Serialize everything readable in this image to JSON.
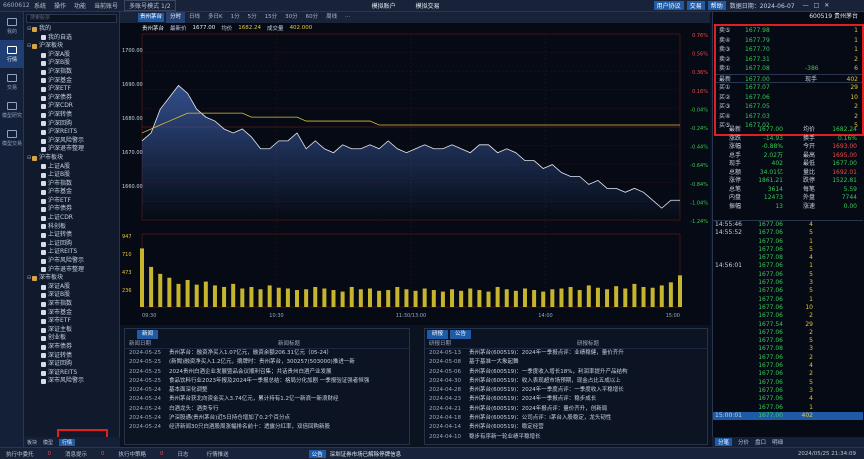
{
  "topbar": {
    "app_id": "6600612",
    "menu": [
      "系统",
      "操作",
      "功能",
      "当前账号"
    ],
    "mode_select": "多账号模式 1/2",
    "center1": "模拟账户",
    "center2": "模拟交易",
    "user_btn": "用户协议",
    "right_btn1": "交易",
    "right_btn2": "帮助",
    "date_text": "数据日期：2024-06-07",
    "colors": {
      "accent": "#1f5aa6",
      "up": "#f04a4a",
      "down": "#39c956"
    }
  },
  "rail": [
    {
      "label": "我的",
      "icon": "user-icon"
    },
    {
      "label": "行情",
      "icon": "chart-icon"
    },
    {
      "label": "交易",
      "icon": "trade-icon"
    },
    {
      "label": "模型研究",
      "icon": "model-icon"
    },
    {
      "label": "模型交易",
      "icon": "robot-icon"
    }
  ],
  "tree": {
    "search_placeholder": "搜索股票",
    "nodes": [
      {
        "label": "我的",
        "lvl": 0,
        "folder": true
      },
      {
        "label": "我的自选",
        "lvl": 1
      },
      {
        "label": "沪深板块",
        "lvl": 0,
        "folder": true
      },
      {
        "label": "沪深A股",
        "lvl": 1
      },
      {
        "label": "沪深B股",
        "lvl": 1
      },
      {
        "label": "沪深指数",
        "lvl": 1
      },
      {
        "label": "沪深基金",
        "lvl": 1
      },
      {
        "label": "沪深ETF",
        "lvl": 1
      },
      {
        "label": "沪深债券",
        "lvl": 1
      },
      {
        "label": "沪深CDR",
        "lvl": 1
      },
      {
        "label": "沪深转债",
        "lvl": 1
      },
      {
        "label": "沪深回购",
        "lvl": 1
      },
      {
        "label": "沪深REITS",
        "lvl": 1
      },
      {
        "label": "沪深风险警示",
        "lvl": 1
      },
      {
        "label": "沪深退市整理",
        "lvl": 1
      },
      {
        "label": "沪市板块",
        "lvl": 0,
        "folder": true
      },
      {
        "label": "上证A股",
        "lvl": 1
      },
      {
        "label": "上证B股",
        "lvl": 1
      },
      {
        "label": "沪市指数",
        "lvl": 1
      },
      {
        "label": "沪市基金",
        "lvl": 1
      },
      {
        "label": "沪市ETF",
        "lvl": 1
      },
      {
        "label": "沪市债券",
        "lvl": 1
      },
      {
        "label": "上证CDR",
        "lvl": 1
      },
      {
        "label": "科创板",
        "lvl": 1
      },
      {
        "label": "上证转债",
        "lvl": 1
      },
      {
        "label": "上证回购",
        "lvl": 1
      },
      {
        "label": "上证REITS",
        "lvl": 1
      },
      {
        "label": "沪市风险警示",
        "lvl": 1
      },
      {
        "label": "沪市退市整理",
        "lvl": 1
      },
      {
        "label": "深市板块",
        "lvl": 0,
        "folder": true
      },
      {
        "label": "深证A股",
        "lvl": 1
      },
      {
        "label": "深证B股",
        "lvl": 1
      },
      {
        "label": "深市指数",
        "lvl": 1
      },
      {
        "label": "深市基金",
        "lvl": 1
      },
      {
        "label": "深市ETF",
        "lvl": 1
      },
      {
        "label": "深证主板",
        "lvl": 1
      },
      {
        "label": "创业板",
        "lvl": 1
      },
      {
        "label": "深市债券",
        "lvl": 1
      },
      {
        "label": "深证转债",
        "lvl": 1
      },
      {
        "label": "深证回购",
        "lvl": 1
      },
      {
        "label": "深证REITS",
        "lvl": 1
      },
      {
        "label": "深市风险警示",
        "lvl": 1
      }
    ],
    "bottom_tabs": [
      "板块",
      "模型",
      "行情"
    ]
  },
  "chart": {
    "stock_button": "贵州茅台",
    "tabs": [
      "分时",
      "日线",
      "多日K",
      "1分",
      "5分",
      "15分",
      "30分",
      "60分",
      "周线",
      "···"
    ],
    "info": [
      "贵州茅台",
      "最新价",
      "1677.00",
      "均价",
      "1682.24",
      "成交量",
      "402.000"
    ],
    "left_axis": [
      "1700.00",
      "1690.00",
      "1680.00",
      "1670.00",
      "1660.00"
    ],
    "right_axis": [
      "0.76%",
      "0.56%",
      "0.36%",
      "0.16%",
      "-0.04%",
      "-0.24%",
      "-0.44%",
      "-0.64%",
      "-0.84%",
      "-1.04%",
      "-1.24%"
    ],
    "vol_axis": [
      "947",
      "710",
      "473",
      "236"
    ],
    "chart_data": {
      "type": "line",
      "xlabel": "",
      "ylabel": "",
      "ylim": [
        1658,
        1705
      ],
      "series": [
        {
          "name": "",
          "values": [
            1678,
            1680,
            1686,
            1689,
            1692,
            1690,
            1686,
            1684,
            1683,
            1681,
            1680,
            1681,
            1679,
            1676,
            1676,
            1678,
            1678,
            1680,
            1676,
            1678,
            1676,
            1675,
            1677,
            1676,
            1676,
            1677,
            1676,
            1678,
            1676,
            1675,
            1676,
            1677,
            1676,
            1676,
            1677,
            1676,
            1675,
            1677,
            1677,
            1675,
            1676,
            1675,
            1673,
            1673,
            1671,
            1672,
            1670,
            1669,
            1669,
            1667,
            1668,
            1666,
            1666,
            1665,
            1666,
            1665,
            1663,
            1661,
            1663,
            1663
          ]
        },
        {
          "name": "",
          "values": [
            1680,
            1681,
            1682,
            1683,
            1684,
            1685,
            1685,
            1685,
            1685,
            1685,
            1685,
            1685,
            1684,
            1684,
            1684,
            1684,
            1684,
            1684,
            1683,
            1683,
            1683,
            1683,
            1683,
            1683,
            1683,
            1683,
            1682,
            1682,
            1682,
            1682,
            1682,
            1682,
            1682,
            1682,
            1682,
            1682,
            1682,
            1682,
            1682,
            1682,
            1682,
            1682,
            1682,
            1682,
            1682,
            1682,
            1682,
            1682,
            1682,
            1682,
            1682,
            1682,
            1682,
            1682,
            1682,
            1682,
            1682,
            1682,
            1682,
            1682
          ]
        }
      ],
      "volume": [
        760,
        520,
        430,
        380,
        300,
        350,
        290,
        330,
        280,
        260,
        300,
        240,
        260,
        230,
        280,
        250,
        240,
        220,
        230,
        260,
        240,
        220,
        200,
        260,
        230,
        240,
        210,
        220,
        260,
        230,
        210,
        240,
        220,
        200,
        230,
        210,
        240,
        220,
        200,
        260,
        230,
        210,
        240,
        220,
        200,
        230,
        240,
        260,
        220,
        280,
        250,
        230,
        270,
        240,
        300,
        260,
        250,
        280,
        320,
        410
      ],
      "x_ticks": [
        "09:30",
        "10:30",
        "11:30/13:00",
        "14:00",
        "15:00"
      ]
    }
  },
  "news_left": {
    "buttons": [
      "新闻"
    ],
    "headers": [
      "新闻日期",
      "新闻标题"
    ],
    "rows": [
      [
        "2024-05-25",
        "贵州茅台：融资净买入1.07亿元，融资余额206.31亿元（05-24）"
      ],
      [
        "2024-05-25",
        "(新聞)融资净买入1.2亿元，摘牌时：贵州茅台，300257(503000)推进一新"
      ],
      [
        "2024-05-25",
        "2024贵州白酒企业发展暨品会议顺利召集；共话贵州白酒产业发展"
      ],
      [
        "2024-05-25",
        "食品饮料行业2023年报及2024年一季报总结：格局分化加剧 一季报验证强者恒强"
      ],
      [
        "2024-05-24",
        "基本面深化调整"
      ],
      [
        "2024-05-24",
        "贵州茅台获北向资金买入3.74亿元，累计持有1.2亿一新浪一新浪财经"
      ],
      [
        "2024-05-24",
        "白酒龙头：酒类专行"
      ],
      [
        "2024-05-24",
        "沪深股通(贵州茅台)近5日持仓增加了0.2个百分点"
      ],
      [
        "2024-05-24",
        "经济新闻30只白酒股周涨幅排名前十：透露分红率，双倍回购新股"
      ]
    ]
  },
  "news_right": {
    "buttons": [
      "研报",
      "公告"
    ],
    "headers": [
      "研报日期",
      "研报标题"
    ],
    "rows": [
      [
        "2024-05-13",
        "贵州茅台(600519)：2024年一季报点评：业绩稳健，量价齐升"
      ],
      [
        "2024-05-08",
        "基于基准一大象起舞"
      ],
      [
        "2024-05-06",
        "贵州茅台(600519)：一季度收入增长18%，利润率提升产品结构"
      ],
      [
        "2024-04-30",
        "贵州茅台(600519)：收入表现超市场预期，现金占比五成以上"
      ],
      [
        "2024-04-28",
        "贵州茅台(600519)：2024年一季度点评：一季度收入平稳增长"
      ],
      [
        "2024-04-23",
        "贵州茅台(600519)：2024年一季报点评：稳步成长"
      ],
      [
        "2024-04-21",
        "贵州茅台(600519)：2024年报点评：量价齐升，创新局"
      ],
      [
        "2024-04-18",
        "贵州茅台(600519)：公司点评：i茅台入股稳定，龙头韧性"
      ],
      [
        "2024-04-14",
        "贵州茅台(600519)：稳定经营"
      ],
      [
        "2024-04-10",
        "稳步有序新一轮业绩平稳增长"
      ]
    ]
  },
  "order_book": {
    "header": "600519 贵州茅台",
    "sells": [
      [
        "卖⑤",
        "1677.98",
        "1",
        ""
      ],
      [
        "卖④",
        "1677.79",
        "1",
        ""
      ],
      [
        "卖③",
        "1677.70",
        "1",
        ""
      ],
      [
        "卖②",
        "1677.31",
        "2",
        ""
      ],
      [
        "卖①",
        "1677.08",
        "6",
        "-386"
      ]
    ],
    "last": [
      "最新",
      "1677.00",
      "现手",
      "402"
    ],
    "buys": [
      [
        "买①",
        "1677.07",
        "29",
        ""
      ],
      [
        "买②",
        "1677.06",
        "10",
        ""
      ],
      [
        "买③",
        "1677.05",
        "2",
        ""
      ],
      [
        "买④",
        "1677.03",
        "2",
        ""
      ],
      [
        "买⑤",
        "1677.02",
        "5",
        ""
      ]
    ]
  },
  "quote": [
    [
      "最新",
      "1677.00",
      "均价",
      "1682.24"
    ],
    [
      "涨跌",
      "-14.93",
      "换手",
      "0.16%"
    ],
    [
      "涨幅",
      "-0.88%",
      "今开",
      "1693.00"
    ],
    [
      "总手",
      "2.02万",
      "最高",
      "1695.00"
    ],
    [
      "现手",
      "402",
      "最低",
      "1677.00"
    ],
    [
      "总额",
      "34.01亿",
      "量比",
      "1692.01"
    ],
    [
      "涨停",
      "1861.21",
      "跌停",
      "1522.81"
    ],
    [
      "总笔",
      "3614",
      "每笔",
      "5.59"
    ],
    [
      "内盘",
      "12473",
      "外盘",
      "7744"
    ],
    [
      "振幅",
      "13",
      "涨速",
      "0.00"
    ]
  ],
  "ticks": [
    [
      "14:55:46",
      "1677.06",
      "4"
    ],
    [
      "14:55:52",
      "1677.06",
      "5"
    ],
    [
      "",
      "1677.06",
      "1"
    ],
    [
      "",
      "1677.06",
      "5"
    ],
    [
      "",
      "1677.08",
      "4"
    ],
    [
      "14:56:01",
      "1677.06",
      "1"
    ],
    [
      "",
      "1677.06",
      "5"
    ],
    [
      "",
      "1677.06",
      "3"
    ],
    [
      "",
      "1677.06",
      "5"
    ],
    [
      "",
      "1677.06",
      "1"
    ],
    [
      "",
      "1677.06",
      "10"
    ],
    [
      "",
      "1677.06",
      "2"
    ],
    [
      "",
      "1677.54",
      "29"
    ],
    [
      "",
      "1677.06",
      "2"
    ],
    [
      "",
      "1677.06",
      "5"
    ],
    [
      "",
      "1677.08",
      "3"
    ],
    [
      "",
      "1677.06",
      "2"
    ],
    [
      "",
      "1677.06",
      "4"
    ],
    [
      "",
      "1677.06",
      "2"
    ],
    [
      "",
      "1677.06",
      "5"
    ],
    [
      "",
      "1677.06",
      "3"
    ],
    [
      "",
      "1677.06",
      "4"
    ],
    [
      "",
      "1677.06",
      "1"
    ],
    [
      "15:00:01",
      "1677.00",
      "402"
    ]
  ],
  "right_tabs": [
    "分笔",
    "分价",
    "盘口",
    "明细"
  ],
  "status": {
    "s1": "执行中委托",
    "s2": "0",
    "s3": "消息提示",
    "s4": "0",
    "s5": "执行中策略",
    "s6": "0",
    "s7": "日志",
    "s8": "行情推送",
    "s9": "公告",
    "s10": "深圳证券市场已解除停牌信息",
    "s11": "2024/05/25 21:34:09"
  }
}
